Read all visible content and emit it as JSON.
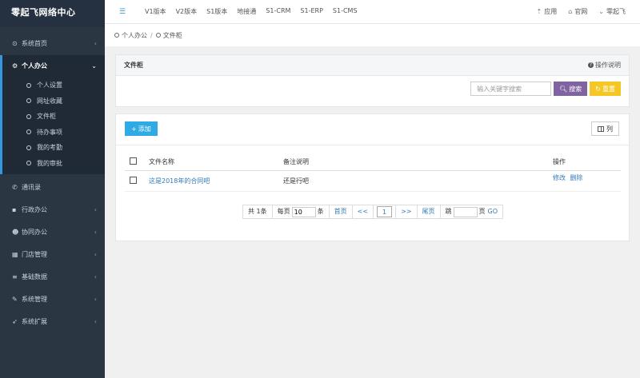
{
  "brand": "零起飞网络中心",
  "topnav": {
    "items": [
      "V1版本",
      "V2版本",
      "S1版本",
      "地接通",
      "S1-CRM",
      "S1-ERP",
      "S1-CMS"
    ],
    "right": [
      {
        "icon": "upload-icon",
        "label": "应用"
      },
      {
        "icon": "home-icon",
        "label": "官网"
      },
      {
        "icon": "chevron-down-icon",
        "label": "零起飞"
      }
    ]
  },
  "sidebar": {
    "home": {
      "label": "系统首页",
      "icon": "home-circle-icon"
    },
    "personal": {
      "label": "个人办公",
      "icon": "gear-icon"
    },
    "sub": [
      "个人设置",
      "网址收藏",
      "文件柜",
      "待办事项",
      "我的考勤",
      "我的审批"
    ],
    "items": [
      {
        "label": "通讯录",
        "icon": "phone-icon",
        "arrow": false
      },
      {
        "label": "行政办公",
        "icon": "briefcase-icon",
        "arrow": true
      },
      {
        "label": "协同办公",
        "icon": "users-icon",
        "arrow": true
      },
      {
        "label": "门店管理",
        "icon": "store-icon",
        "arrow": true
      },
      {
        "label": "基础数据",
        "icon": "database-icon",
        "arrow": true
      },
      {
        "label": "系统管理",
        "icon": "wrench-icon",
        "arrow": true
      },
      {
        "label": "系统扩展",
        "icon": "rocket-icon",
        "arrow": true
      }
    ]
  },
  "breadcrumb": [
    "个人办公",
    "文件柜"
  ],
  "filter": {
    "title": "文件柜",
    "help": "操作说明",
    "placeholder": "输入关键字搜索",
    "search_label": "搜索",
    "reset_label": "重置"
  },
  "list": {
    "add_label": "添加",
    "columns_label": "列",
    "headers": [
      "文件名称",
      "备注说明",
      "操作"
    ],
    "rows": [
      {
        "name": "这是2018年的合同吧",
        "note": "还是行吧",
        "edit": "修改",
        "delete": "删除"
      }
    ]
  },
  "pager": {
    "total": "共 1条",
    "per_page_prefix": "每页",
    "per_page": "10",
    "per_page_suffix": "条",
    "first": "首页",
    "prev": "<<",
    "current": "1",
    "next": ">>",
    "last": "尾页",
    "jump_prefix": "跳",
    "jump_suffix": "页",
    "go": "GO"
  }
}
